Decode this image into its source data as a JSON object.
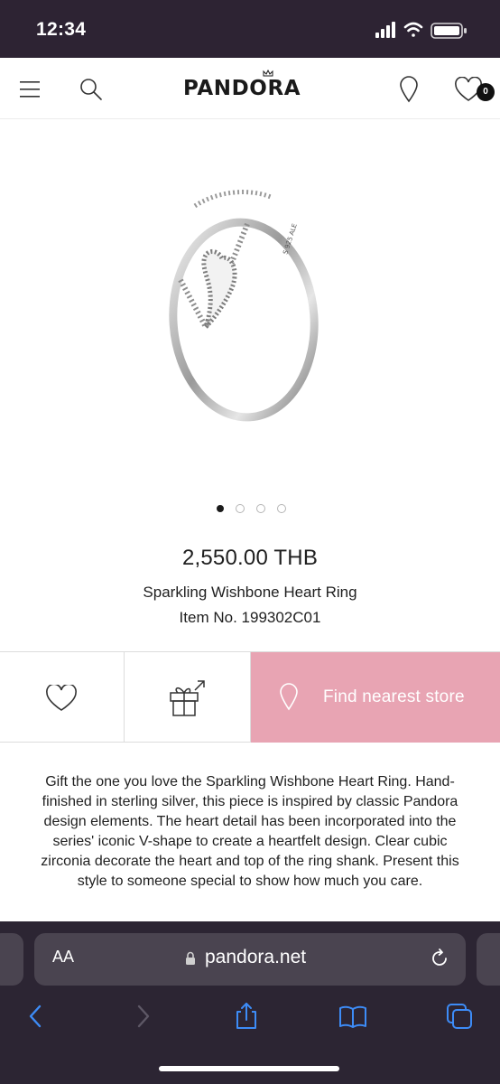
{
  "status_bar": {
    "time": "12:34",
    "icons": [
      "cellular-signal-icon",
      "wifi-icon",
      "battery-icon"
    ]
  },
  "header": {
    "logo_text": "PANDORA",
    "menu_icon": "hamburger-menu-icon",
    "search_icon": "search-icon",
    "store_locator_icon": "location-pin-icon",
    "wishlist_icon": "heart-icon",
    "wishlist_count": "0"
  },
  "product": {
    "image": "ring-product-image",
    "carousel": {
      "total": 4,
      "active": 1
    },
    "price": "2,550.00 THB",
    "name": "Sparkling Wishbone Heart Ring",
    "item_label": "Item No.",
    "item_number": "199302C01"
  },
  "actions": {
    "wishlist_icon": "heart-outline-icon",
    "gift_icon": "gift-share-icon",
    "store_button_label": "Find nearest store",
    "store_icon": "location-pin-icon"
  },
  "description": "Gift the one you love the Sparkling Wishbone Heart Ring. Hand-finished in sterling silver, this piece is inspired by classic Pandora design elements. The heart detail has been incorporated into the series' iconic V-shape to create a heartfelt design. Clear cubic zirconia decorate the heart and top of the ring shank. Present this style to someone special to show how much you care.",
  "browser": {
    "text_size_label": "AA",
    "url": "pandora.net",
    "toolbar": [
      "back-icon",
      "forward-icon",
      "share-icon",
      "bookmarks-icon",
      "tabs-icon"
    ]
  },
  "colors": {
    "status_bar_bg": "#2d2333",
    "accent_pink": "#e8a4b3",
    "browser_bg": "#2c2533",
    "toolbar_blue": "#3d8cf7"
  }
}
